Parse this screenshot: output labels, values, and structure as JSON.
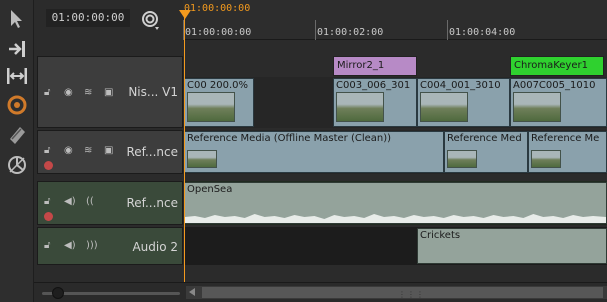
{
  "header": {
    "timecode": "01:00:00:00",
    "current_time": "01:00:00:00"
  },
  "ruler": {
    "labels": [
      "01:00:00:00",
      "01:00:02:00",
      "01:00:04:00"
    ]
  },
  "tools": {
    "items": [
      "select-tool-icon",
      "track-select-tool-icon",
      "slip-tool-icon",
      "razor-tool-icon",
      "multi-tool-icon",
      "retime-tool-icon"
    ]
  },
  "tracks": {
    "v1": {
      "name": "Nis... V1"
    },
    "ref": {
      "name": "Ref...nce"
    },
    "audio_ref": {
      "name": "Ref...nce"
    },
    "audio2": {
      "name": "Audio 2"
    }
  },
  "effects": {
    "mirror": {
      "label": "Mirror2_1",
      "color": "#b78ac6"
    },
    "chroma": {
      "label": "ChromaKeyer1",
      "color": "#2fd12f"
    }
  },
  "v1_clips": [
    {
      "label": "C00 200.0%"
    },
    {
      "label": "C003_006_301"
    },
    {
      "label": "C004_001_3010"
    },
    {
      "label": "A007C005_1010"
    }
  ],
  "ref_clips": [
    {
      "label": "Reference Media (Offline Master (Clean))"
    },
    {
      "label": "Reference Med"
    },
    {
      "label": "Reference Me"
    }
  ],
  "audio_clips": {
    "opensea": "OpenSea",
    "crickets": "Crickets"
  },
  "colors": {
    "playhead": "#f39a1e",
    "video_clip": "#8aa1ac",
    "audio_clip": "#94a39b"
  }
}
